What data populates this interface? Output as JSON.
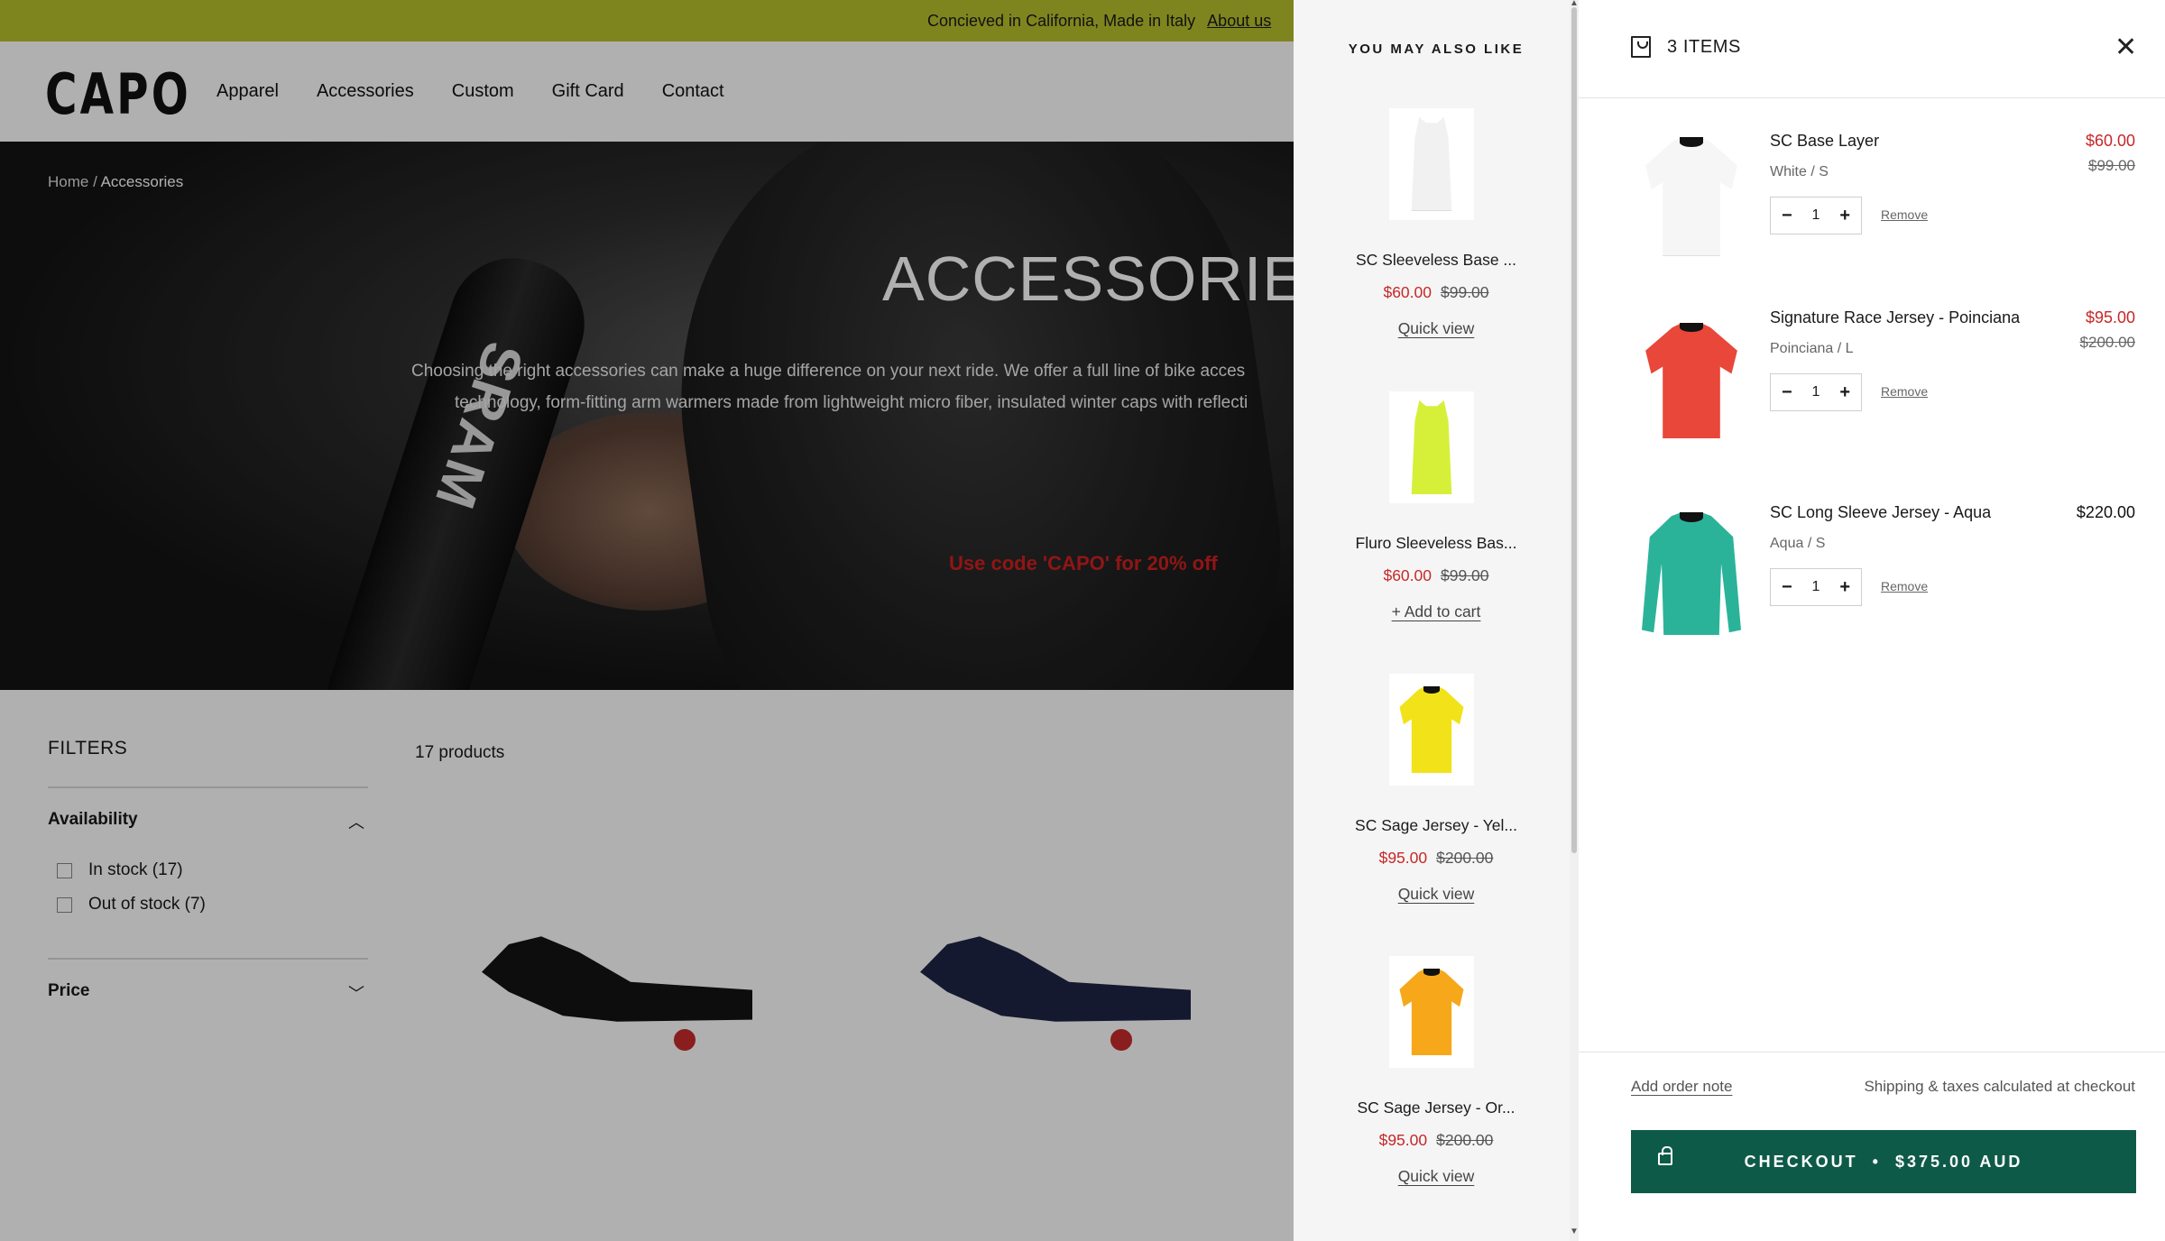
{
  "announcement": {
    "text": "Concieved in California, Made in Italy",
    "link": "About us"
  },
  "header": {
    "logo": "CAPO",
    "nav": [
      "Apparel",
      "Accessories",
      "Custom",
      "Gift Card",
      "Contact"
    ]
  },
  "hero": {
    "breadcrumb_home": "Home",
    "breadcrumb_sep": " / ",
    "breadcrumb_current": "Accessories",
    "title": "ACCESSORIES",
    "description_line1": "Choosing the right accessories can make a huge difference on your next ride.  We offer a full line of bike acces",
    "description_line2": "technology, form-fitting arm warmers made from lightweight micro fiber, insulated winter caps with reflecti",
    "promo": "Use code 'CAPO' for 20% off",
    "lever_text": "SRAM"
  },
  "filters": {
    "heading": "FILTERS",
    "availability_label": "Availability",
    "options": [
      "In stock (17)",
      "Out of stock (7)"
    ],
    "price_label": "Price"
  },
  "catalog": {
    "count": "17 products"
  },
  "recommendations": {
    "heading": "YOU MAY ALSO LIKE",
    "items": [
      {
        "name": "SC Sleeveless Base ...",
        "price": "$60.00",
        "compare": "$99.00",
        "action": "Quick view",
        "color": "#f4f4f4",
        "kind": "vest"
      },
      {
        "name": "Fluro Sleeveless Bas...",
        "price": "$60.00",
        "compare": "$99.00",
        "action": "+ Add to cart",
        "color": "#d6f03a",
        "kind": "vest"
      },
      {
        "name": "SC Sage Jersey - Yel...",
        "price": "$95.00",
        "compare": "$200.00",
        "action": "Quick view",
        "color": "#f2e21a",
        "kind": "shirt"
      },
      {
        "name": "SC Sage Jersey - Or...",
        "price": "$95.00",
        "compare": "$200.00",
        "action": "Quick view",
        "color": "#f6a81a",
        "kind": "shirt"
      }
    ]
  },
  "cart": {
    "title": "3 ITEMS",
    "items": [
      {
        "title": "SC Base Layer",
        "variant": "White / S",
        "price": "$60.00",
        "compare": "$99.00",
        "qty": "1",
        "remove": "Remove",
        "color": "#f6f6f6",
        "kind": "shirt"
      },
      {
        "title": "Signature Race Jersey - Poinciana",
        "variant": "Poinciana / L",
        "price": "$95.00",
        "compare": "$200.00",
        "qty": "1",
        "remove": "Remove",
        "color": "#e8473a",
        "kind": "shirt"
      },
      {
        "title": "SC Long Sleeve Jersey - Aqua",
        "variant": "Aqua / S",
        "price": "$220.00",
        "compare": "",
        "qty": "1",
        "remove": "Remove",
        "color": "#2bb39a",
        "kind": "lsleeve"
      }
    ],
    "qty_minus": "−",
    "qty_plus": "+",
    "order_note": "Add order note",
    "shipping_note": "Shipping & taxes calculated at checkout",
    "checkout_label": "CHECKOUT",
    "checkout_sep": "•",
    "checkout_total": "$375.00 AUD"
  },
  "colors": {
    "announcement_bg": "#b8c12c",
    "checkout_bg": "#0e5a49",
    "sale_red": "#c62828",
    "promo_red": "#d21f1f"
  }
}
